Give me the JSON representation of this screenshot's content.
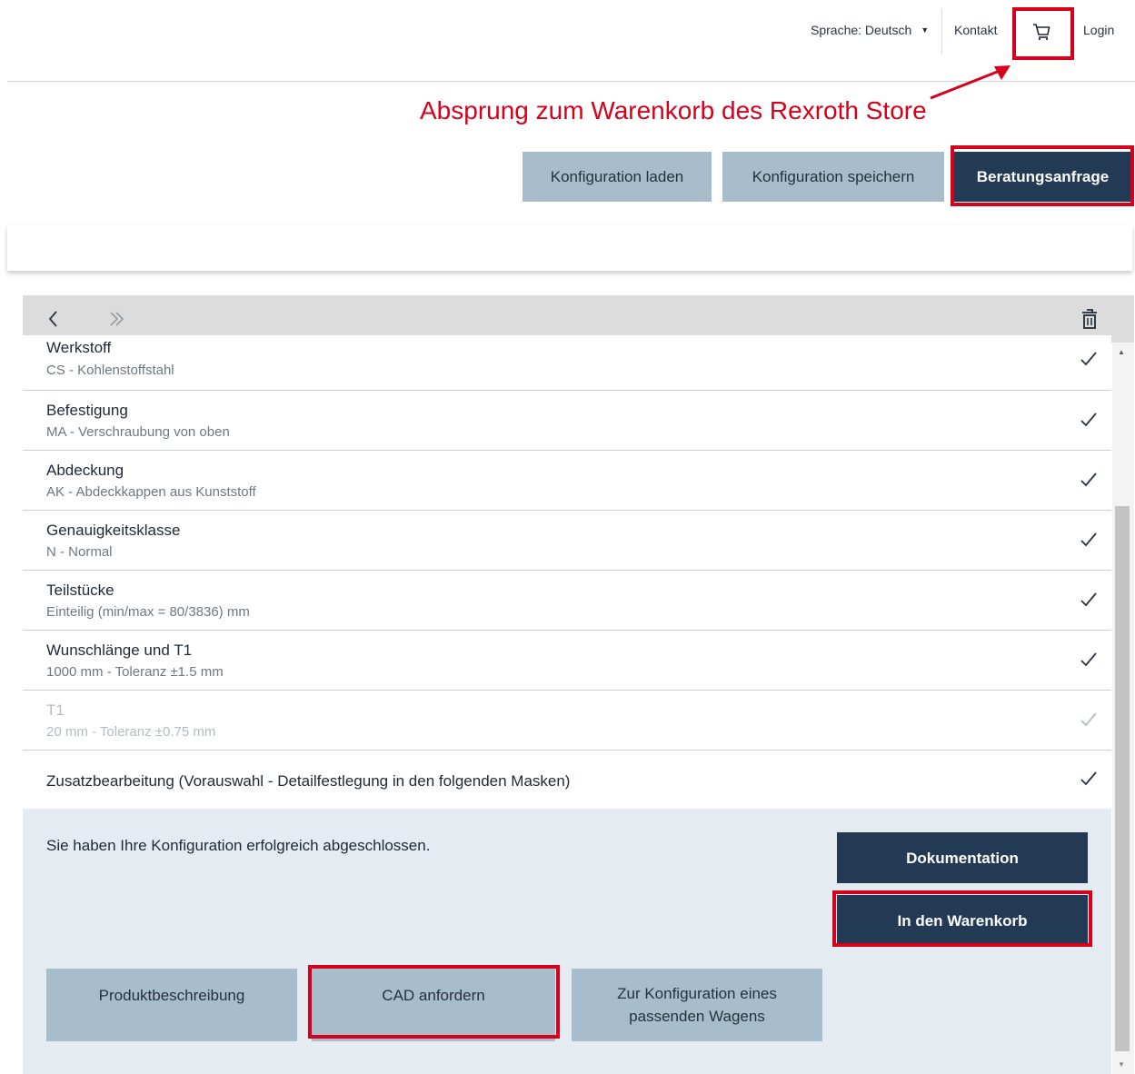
{
  "topnav": {
    "language": "Sprache: Deutsch",
    "contact": "Kontakt",
    "login": "Login"
  },
  "annotation": {
    "text": "Absprung zum Warenkorb des Rexroth Store",
    "color": "#d6001c"
  },
  "actions": {
    "load": "Konfiguration laden",
    "save": "Konfiguration speichern",
    "consult": "Beratungsanfrage"
  },
  "toolbar": {
    "back_icon": "chevron-left-icon",
    "forward_icon": "double-chevron-right-icon",
    "delete_icon": "trash-icon"
  },
  "config": {
    "items": [
      {
        "title": "Werkstoff",
        "value": "CS - Kohlenstoffstahl"
      },
      {
        "title": "Befestigung",
        "value": "MA - Verschraubung von oben"
      },
      {
        "title": "Abdeckung",
        "value": "AK - Abdeckkappen aus Kunststoff"
      },
      {
        "title": "Genauigkeitsklasse",
        "value": "N - Normal"
      },
      {
        "title": "Teilstücke",
        "value": "Einteilig (min/max = 80/3836) mm"
      },
      {
        "title": "Wunschlänge und T1",
        "value": "1000 mm - Toleranz ±1.5 mm"
      },
      {
        "title": "T1",
        "value": "20 mm - Toleranz ±0.75 mm"
      },
      {
        "title": "Zusatzbearbeitung (Vorauswahl - Detailfestlegung in den folgenden Masken)"
      }
    ]
  },
  "complete": {
    "message": "Sie haben Ihre Konfiguration erfolgreich abgeschlossen.",
    "documentation": "Dokumentation",
    "add_to_cart": "In den Warenkorb",
    "product_description": "Produktbeschreibung",
    "request_cad": "CAD anfordern",
    "configure_carriage": "Zur Konfiguration eines passenden Wagens"
  },
  "colors": {
    "primary_dark": "#233a55",
    "secondary": "#a8bdcb",
    "highlight": "#d6001c"
  }
}
